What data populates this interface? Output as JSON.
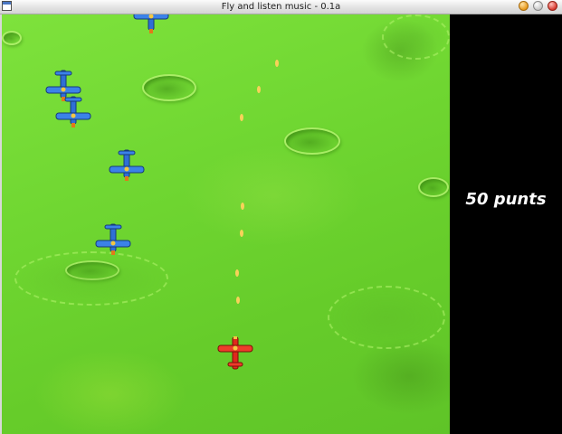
{
  "window": {
    "title": "Fly and listen music - 0.1a"
  },
  "hud": {
    "score": "50 punts"
  },
  "colors": {
    "terrain": "#6fd631",
    "sidebar": "#000000",
    "enemy": "#2f6fd6",
    "player": "#e0281c",
    "bullet": "#f7d25a"
  },
  "sprites": {
    "enemy_icon": "blue-biplane-icon",
    "player_icon": "red-biplane-icon",
    "bullet_icon": "bullet-icon"
  }
}
